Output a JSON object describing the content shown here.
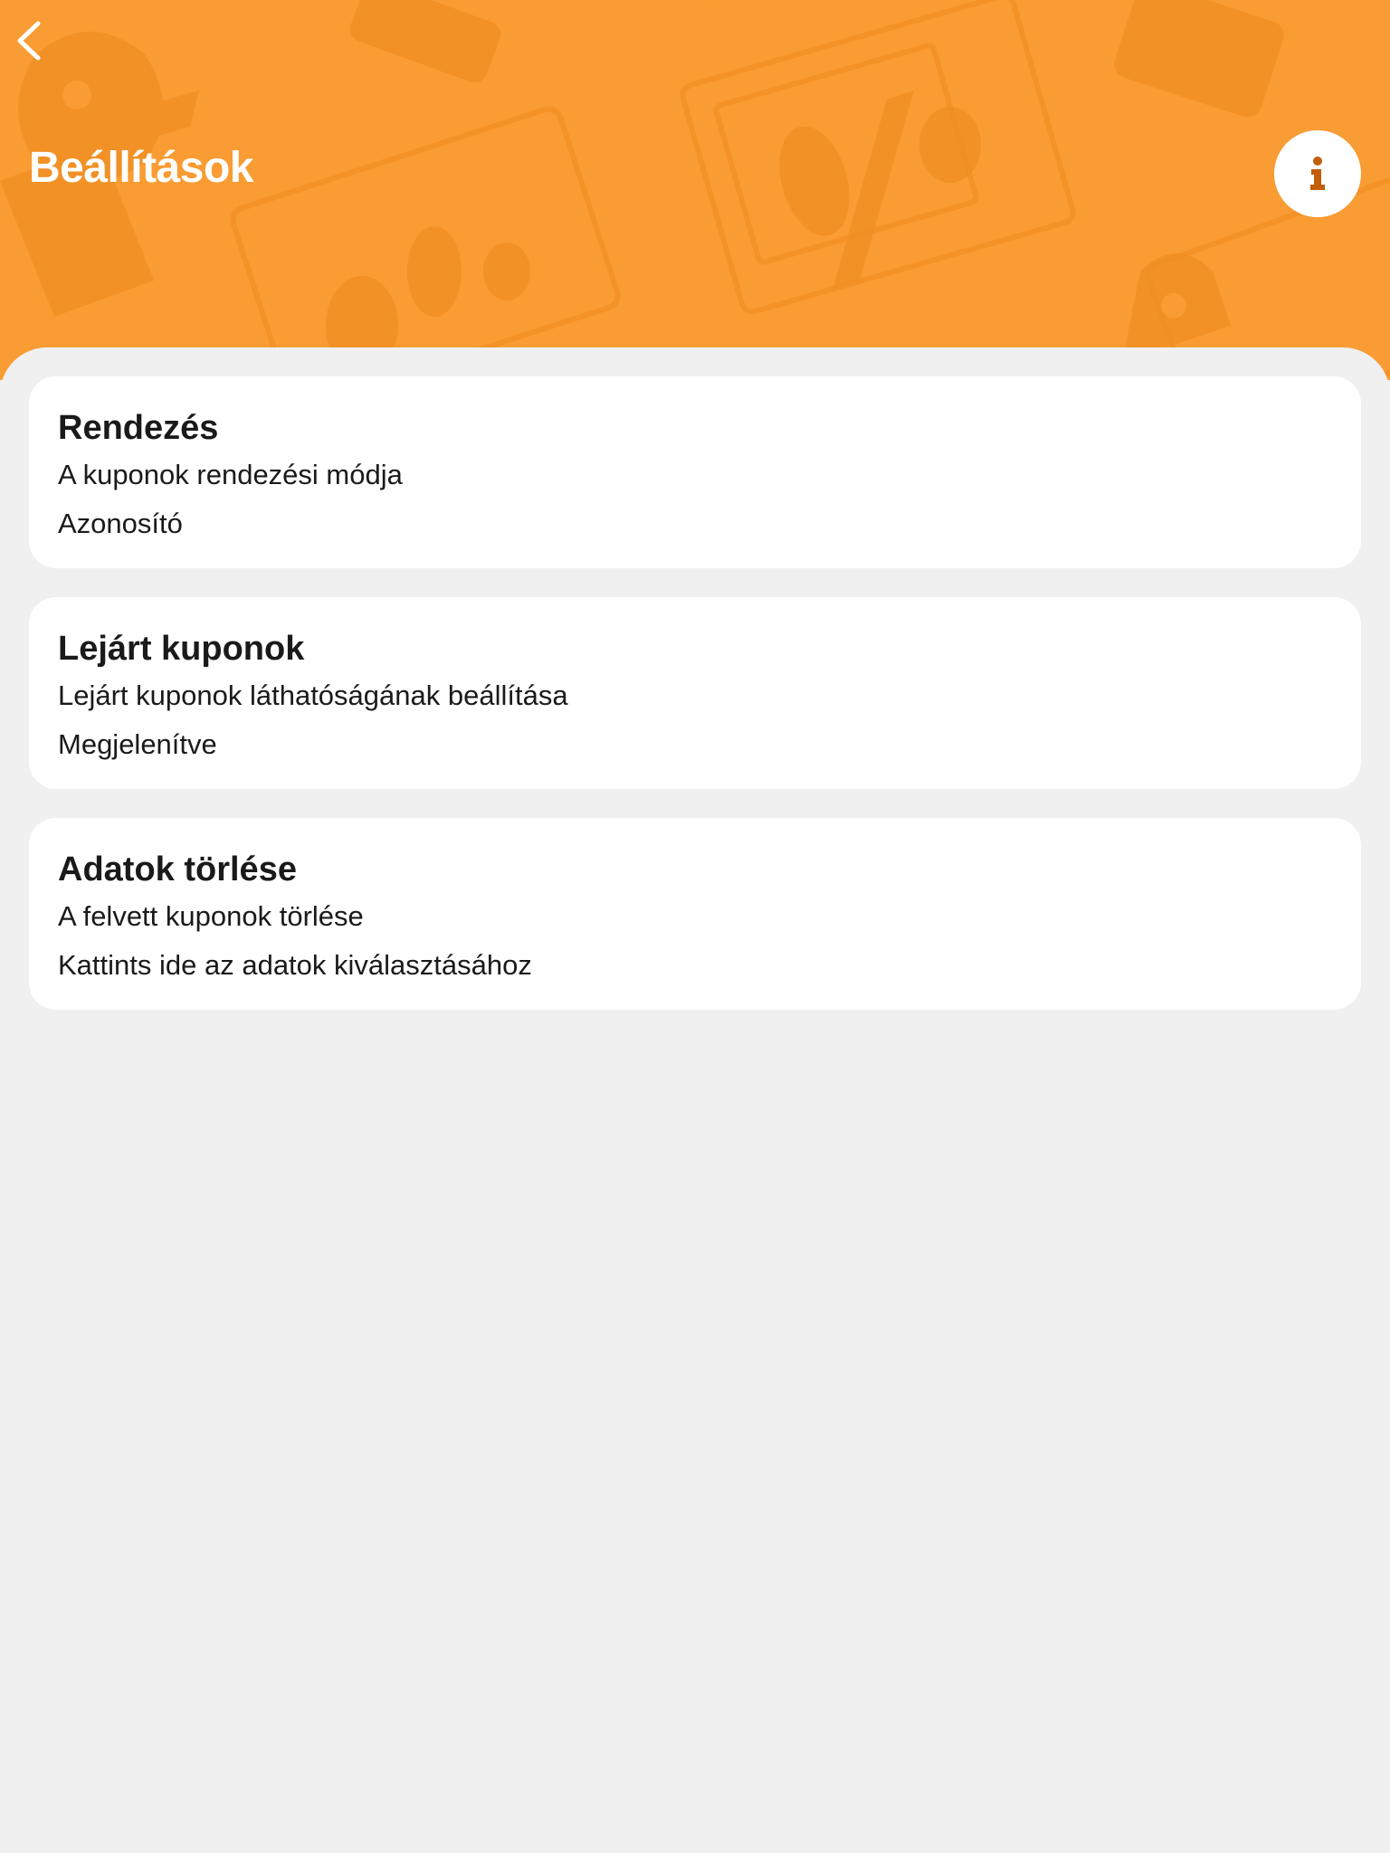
{
  "header": {
    "title": "Beállítások",
    "back_icon": "chevron-left-icon",
    "info_icon": "info-icon",
    "background_color": "#f99c33",
    "accent_color": "#c15f0a"
  },
  "settings": [
    {
      "title": "Rendezés",
      "description": "A kuponok rendezési módja",
      "value": "Azonosító"
    },
    {
      "title": "Lejárt kuponok",
      "description": "Lejárt kuponok láthatóságának beállítása",
      "value": "Megjelenítve"
    },
    {
      "title": "Adatok törlése",
      "description": "A felvett kuponok törlése",
      "value": "Kattints ide az adatok kiválasztásához"
    }
  ]
}
